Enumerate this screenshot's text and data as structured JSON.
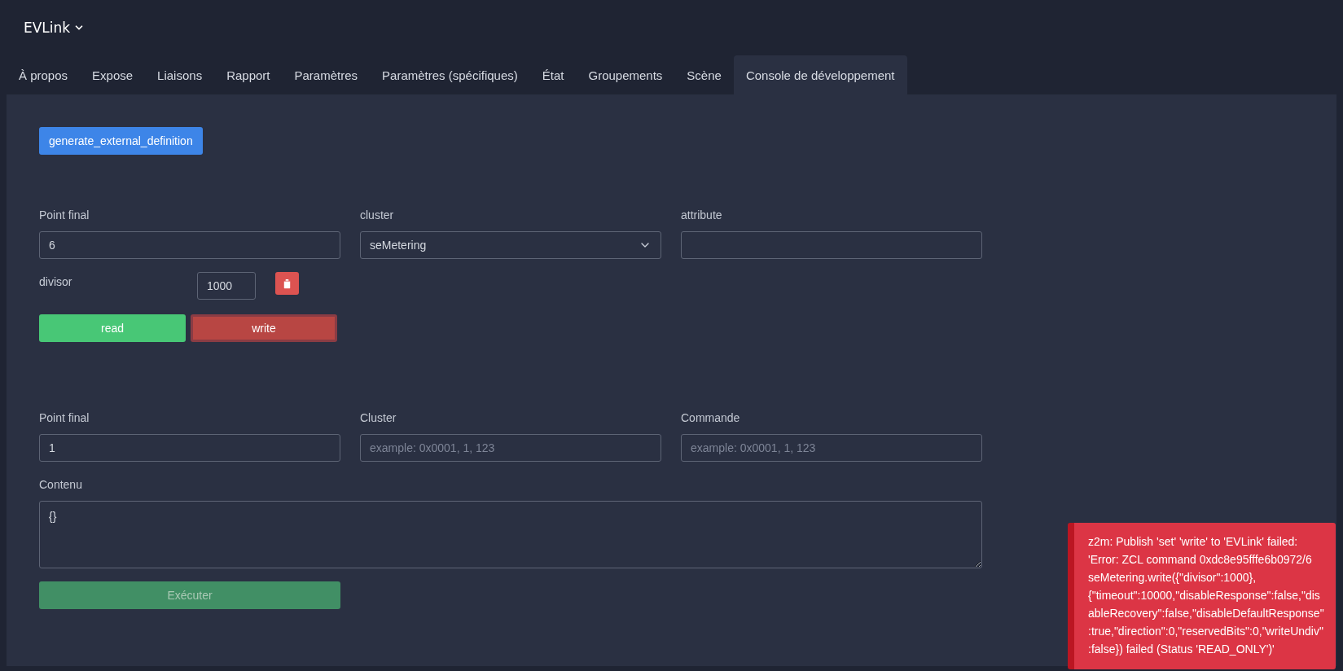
{
  "device": {
    "name": "EVLink"
  },
  "tabs": [
    {
      "label": "À propos",
      "selected": false
    },
    {
      "label": "Expose",
      "selected": false
    },
    {
      "label": "Liaisons",
      "selected": false
    },
    {
      "label": "Rapport",
      "selected": false
    },
    {
      "label": "Paramètres",
      "selected": false
    },
    {
      "label": "Paramètres (spécifiques)",
      "selected": false
    },
    {
      "label": "État",
      "selected": false
    },
    {
      "label": "Groupements",
      "selected": false
    },
    {
      "label": "Scène",
      "selected": false
    },
    {
      "label": "Console de développement",
      "selected": true
    }
  ],
  "generate_button": "generate_external_definition",
  "attribute_form": {
    "endpoint": {
      "label": "Point final",
      "value": "6"
    },
    "cluster": {
      "label": "cluster",
      "value": "seMetering"
    },
    "attribute": {
      "label": "attribute"
    },
    "attributes": [
      {
        "name": "divisor",
        "value": "1000"
      }
    ],
    "read_button": "read",
    "write_button": {
      "label": "write",
      "focused": true
    }
  },
  "command_form": {
    "endpoint": {
      "label": "Point final",
      "value": "1"
    },
    "cluster": {
      "label": "Cluster",
      "placeholder": "example: 0x0001, 1, 123"
    },
    "command": {
      "label": "Commande",
      "placeholder": "example: 0x0001, 1, 123"
    },
    "payload": {
      "label": "Contenu",
      "value": "{}"
    },
    "execute_button": {
      "label": "Exécuter",
      "disabled": true
    }
  },
  "toast": {
    "kind": "error",
    "message": "z2m: Publish 'set' 'write' to 'EVLink' failed: 'Error: ZCL command 0xdc8e95fffe6b0972/6 seMetering.write({\"divisor\":1000}, {\"timeout\":10000,\"disableResponse\":false,\"disableRecovery\":false,\"disableDefaultResponse\":true,\"direction\":0,\"reservedBits\":0,\"writeUndiv\":false}) failed (Status 'READ_ONLY')'"
  }
}
